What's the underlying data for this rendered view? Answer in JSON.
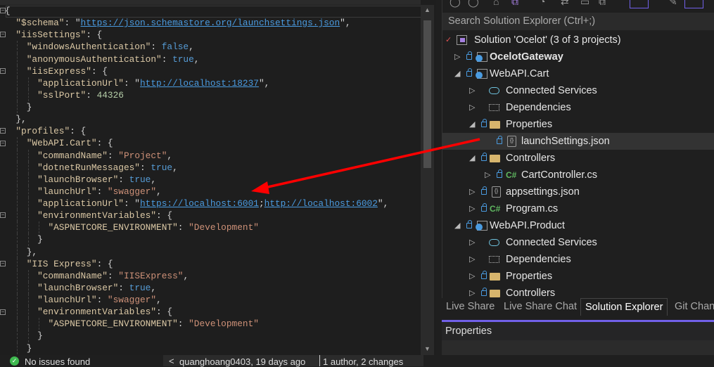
{
  "editor": {
    "lines": [
      {
        "i": 0,
        "t": [
          [
            "p",
            "{"
          ]
        ]
      },
      {
        "i": 1,
        "t": [
          [
            "k",
            "\"$schema\""
          ],
          [
            "p",
            ": \""
          ],
          [
            "l",
            "https://json.schemastore.org/launchsettings.json"
          ],
          [
            "p",
            "\","
          ]
        ]
      },
      {
        "i": 1,
        "t": [
          [
            "k",
            "\"iisSettings\""
          ],
          [
            "p",
            ": {"
          ]
        ]
      },
      {
        "i": 2,
        "t": [
          [
            "k",
            "\"windowsAuthentication\""
          ],
          [
            "p",
            ": "
          ],
          [
            "b",
            "false"
          ],
          [
            "p",
            ","
          ]
        ]
      },
      {
        "i": 2,
        "t": [
          [
            "k",
            "\"anonymousAuthentication\""
          ],
          [
            "p",
            ": "
          ],
          [
            "b",
            "true"
          ],
          [
            "p",
            ","
          ]
        ]
      },
      {
        "i": 2,
        "t": [
          [
            "k",
            "\"iisExpress\""
          ],
          [
            "p",
            ": {"
          ]
        ]
      },
      {
        "i": 3,
        "t": [
          [
            "k",
            "\"applicationUrl\""
          ],
          [
            "p",
            ": \""
          ],
          [
            "l",
            "http://localhost:18237"
          ],
          [
            "p",
            "\","
          ]
        ]
      },
      {
        "i": 3,
        "t": [
          [
            "k",
            "\"sslPort\""
          ],
          [
            "p",
            ": "
          ],
          [
            "n",
            "44326"
          ]
        ]
      },
      {
        "i": 2,
        "t": [
          [
            "p",
            "}"
          ]
        ]
      },
      {
        "i": 1,
        "t": [
          [
            "p",
            "},"
          ]
        ]
      },
      {
        "i": 1,
        "t": [
          [
            "k",
            "\"profiles\""
          ],
          [
            "p",
            ": {"
          ]
        ]
      },
      {
        "i": 2,
        "t": [
          [
            "k",
            "\"WebAPI.Cart\""
          ],
          [
            "p",
            ": {"
          ]
        ]
      },
      {
        "i": 3,
        "t": [
          [
            "k",
            "\"commandName\""
          ],
          [
            "p",
            ": "
          ],
          [
            "s",
            "\"Project\""
          ],
          [
            "p",
            ","
          ]
        ]
      },
      {
        "i": 3,
        "t": [
          [
            "k",
            "\"dotnetRunMessages\""
          ],
          [
            "p",
            ": "
          ],
          [
            "b",
            "true"
          ],
          [
            "p",
            ","
          ]
        ]
      },
      {
        "i": 3,
        "t": [
          [
            "k",
            "\"launchBrowser\""
          ],
          [
            "p",
            ": "
          ],
          [
            "b",
            "true"
          ],
          [
            "p",
            ","
          ]
        ]
      },
      {
        "i": 3,
        "t": [
          [
            "k",
            "\"launchUrl\""
          ],
          [
            "p",
            ": "
          ],
          [
            "s",
            "\"swagger\""
          ],
          [
            "p",
            ","
          ]
        ]
      },
      {
        "i": 3,
        "t": [
          [
            "k",
            "\"applicationUrl\""
          ],
          [
            "p",
            ": \""
          ],
          [
            "l",
            "https://localhost:6001"
          ],
          [
            "p",
            ";"
          ],
          [
            "l",
            "http://localhost:6002"
          ],
          [
            "p",
            "\","
          ]
        ]
      },
      {
        "i": 3,
        "t": [
          [
            "k",
            "\"environmentVariables\""
          ],
          [
            "p",
            ": {"
          ]
        ]
      },
      {
        "i": 4,
        "t": [
          [
            "k",
            "\"ASPNETCORE_ENVIRONMENT\""
          ],
          [
            "p",
            ": "
          ],
          [
            "s",
            "\"Development\""
          ]
        ]
      },
      {
        "i": 3,
        "t": [
          [
            "p",
            "}"
          ]
        ]
      },
      {
        "i": 2,
        "t": [
          [
            "p",
            "},"
          ]
        ]
      },
      {
        "i": 2,
        "t": [
          [
            "k",
            "\"IIS Express\""
          ],
          [
            "p",
            ": {"
          ]
        ]
      },
      {
        "i": 3,
        "t": [
          [
            "k",
            "\"commandName\""
          ],
          [
            "p",
            ": "
          ],
          [
            "s",
            "\"IISExpress\""
          ],
          [
            "p",
            ","
          ]
        ]
      },
      {
        "i": 3,
        "t": [
          [
            "k",
            "\"launchBrowser\""
          ],
          [
            "p",
            ": "
          ],
          [
            "b",
            "true"
          ],
          [
            "p",
            ","
          ]
        ]
      },
      {
        "i": 3,
        "t": [
          [
            "k",
            "\"launchUrl\""
          ],
          [
            "p",
            ": "
          ],
          [
            "s",
            "\"swagger\""
          ],
          [
            "p",
            ","
          ]
        ]
      },
      {
        "i": 3,
        "t": [
          [
            "k",
            "\"environmentVariables\""
          ],
          [
            "p",
            ": {"
          ]
        ]
      },
      {
        "i": 4,
        "t": [
          [
            "k",
            "\"ASPNETCORE_ENVIRONMENT\""
          ],
          [
            "p",
            ": "
          ],
          [
            "s",
            "\"Development\""
          ]
        ]
      },
      {
        "i": 3,
        "t": [
          [
            "p",
            "}"
          ]
        ]
      },
      {
        "i": 2,
        "t": [
          [
            "p",
            "}"
          ]
        ]
      }
    ]
  },
  "status": {
    "issues": "No issues found",
    "blame": "quanghoang0403, 19 days ago",
    "changes": "1 author, 2 changes"
  },
  "solution_explorer": {
    "search_placeholder": "Search Solution Explorer (Ctrl+;)",
    "items": [
      {
        "label": "Solution 'Ocelot' (3 of 3 projects)",
        "level": 0,
        "exp": "",
        "lock": false,
        "icon": "solution",
        "check": true
      },
      {
        "label": "OcelotGateway",
        "level": 1,
        "exp": "collapsed",
        "lock": true,
        "icon": "project",
        "bold": true
      },
      {
        "label": "WebAPI.Cart",
        "level": 1,
        "exp": "expanded",
        "lock": true,
        "icon": "project"
      },
      {
        "label": "Connected Services",
        "level": 2,
        "exp": "collapsed",
        "lock": false,
        "icon": "connected"
      },
      {
        "label": "Dependencies",
        "level": 2,
        "exp": "collapsed",
        "lock": false,
        "icon": "dependencies"
      },
      {
        "label": "Properties",
        "level": 2,
        "exp": "expanded",
        "lock": true,
        "icon": "properties"
      },
      {
        "label": "launchSettings.json",
        "level": 3,
        "exp": "",
        "lock": true,
        "icon": "json",
        "selected": true
      },
      {
        "label": "Controllers",
        "level": 2,
        "exp": "expanded",
        "lock": true,
        "icon": "folder"
      },
      {
        "label": "CartController.cs",
        "level": 3,
        "exp": "collapsed",
        "lock": true,
        "icon": "csharp"
      },
      {
        "label": "appsettings.json",
        "level": 2,
        "exp": "collapsed",
        "lock": true,
        "icon": "json"
      },
      {
        "label": "Program.cs",
        "level": 2,
        "exp": "collapsed",
        "lock": true,
        "icon": "csharp"
      },
      {
        "label": "WebAPI.Product",
        "level": 1,
        "exp": "expanded",
        "lock": true,
        "icon": "project"
      },
      {
        "label": "Connected Services",
        "level": 2,
        "exp": "collapsed",
        "lock": false,
        "icon": "connected"
      },
      {
        "label": "Dependencies",
        "level": 2,
        "exp": "collapsed",
        "lock": false,
        "icon": "dependencies"
      },
      {
        "label": "Properties",
        "level": 2,
        "exp": "collapsed",
        "lock": true,
        "icon": "properties"
      },
      {
        "label": "Controllers",
        "level": 2,
        "exp": "collapsed",
        "lock": true,
        "icon": "folder"
      }
    ]
  },
  "tabs": [
    {
      "label": "Live Share"
    },
    {
      "label": "Live Share Chat"
    },
    {
      "label": "Solution Explorer",
      "active": true
    },
    {
      "label": "Git Chan"
    }
  ],
  "properties": {
    "title": "Properties"
  },
  "colors": {
    "annotation_arrow": "#ff0000",
    "accent": "#7160e8"
  }
}
